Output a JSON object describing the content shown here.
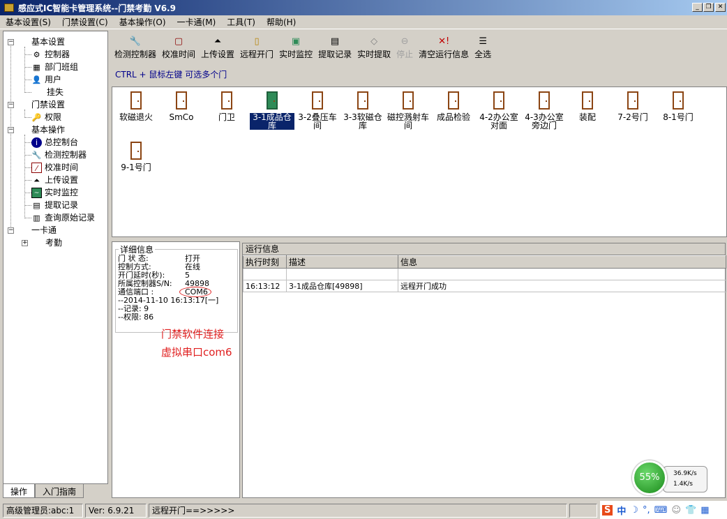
{
  "window": {
    "title": "感应式IC智能卡管理系统--门禁考勤 V6.9"
  },
  "menu": [
    "基本设置(S)",
    "门禁设置(C)",
    "基本操作(O)",
    "一卡通(M)",
    "工具(T)",
    "帮助(H)"
  ],
  "tree": {
    "groups": [
      {
        "label": "基本设置",
        "items": [
          "控制器",
          "部门班组",
          "用户",
          "挂失"
        ]
      },
      {
        "label": "门禁设置",
        "items": [
          "权限"
        ]
      },
      {
        "label": "基本操作",
        "items": [
          "总控制台",
          "检测控制器",
          "校准时间",
          "上传设置",
          "实时监控",
          "提取记录",
          "查询原始记录"
        ]
      },
      {
        "label": "一卡通",
        "items": [
          "考勤"
        ]
      }
    ]
  },
  "tabs": [
    "操作",
    "入门指南"
  ],
  "toolbar": [
    "检测控制器",
    "校准时间",
    "上传设置",
    "远程开门",
    "实时监控",
    "提取记录",
    "实时提取",
    "停止",
    "清空运行信息",
    "全选"
  ],
  "hint": "CTRL + 鼠标左键 可选多个门",
  "doors": [
    {
      "label": "软磁退火"
    },
    {
      "label": "SmCo"
    },
    {
      "label": "门卫"
    },
    {
      "label": "3-1成品仓库",
      "selected": true
    },
    {
      "label": "3-2叠压车间"
    },
    {
      "label": "3-3软磁仓库"
    },
    {
      "label": "磁控溅射车间"
    },
    {
      "label": "成品检验"
    },
    {
      "label": "4-2办公室对面"
    },
    {
      "label": "4-3办公室旁边门"
    },
    {
      "label": "装配"
    },
    {
      "label": "7-2号门"
    },
    {
      "label": "8-1号门"
    },
    {
      "label": "9-1号门"
    }
  ],
  "detail": {
    "legend": "详细信息",
    "rows": [
      {
        "k": "门 状 态:",
        "v": "打开"
      },
      {
        "k": "控制方式:",
        "v": "在线"
      },
      {
        "k": "开门延时(秒):",
        "v": "5"
      },
      {
        "k": "所属控制器S/N:",
        "v": "49898"
      },
      {
        "k": "通信端口 :",
        "v": "COM6"
      }
    ],
    "extra": [
      "--2014-11-10 16:13:17[一]",
      "--记录: 9",
      "--权限: 86"
    ],
    "note1": "门禁软件连接",
    "note2": "虚拟串口com6"
  },
  "runinfo": {
    "caption": "运行信息",
    "headers": [
      "执行时刻",
      "描述",
      "信息"
    ],
    "rows": [
      [
        "16:13:12",
        "3-1成品仓库[49898]",
        "远程开门成功"
      ]
    ]
  },
  "status": {
    "user": "高级管理员:abc:1",
    "ver": "Ver: 6.9.21",
    "msg": "远程开门==>>>>>"
  },
  "net": {
    "pct": "55%",
    "up": "36.9K/s",
    "down": "1.4K/s"
  },
  "ime": {
    "lang": "中"
  }
}
